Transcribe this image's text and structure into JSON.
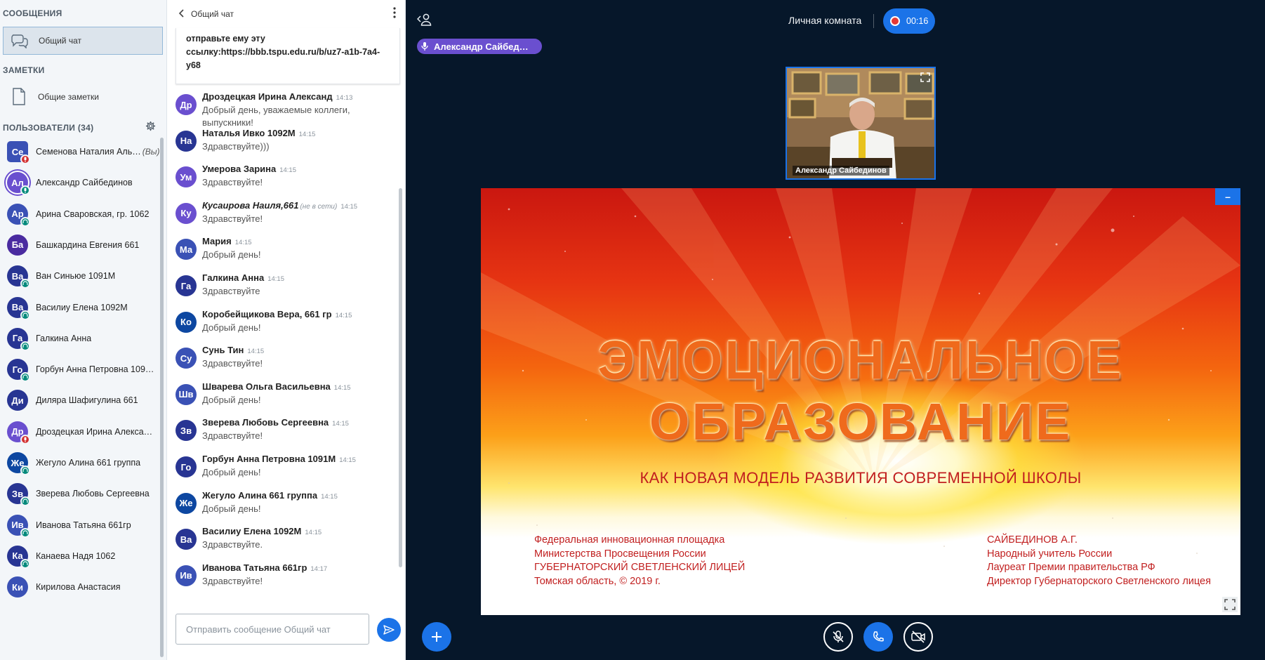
{
  "sidebar": {
    "messages_title": "СООБЩЕНИЯ",
    "public_chat": "Общий чат",
    "notes_title": "ЗАМЕТКИ",
    "shared_notes": "Общие заметки",
    "users_title": "ПОЛЬЗОВАТЕЛИ (34)",
    "you_label": "(Вы)",
    "users": [
      {
        "initials": "Се",
        "name": "Семенова Наталия Аль…",
        "color": "#3a51b5",
        "status": "muted",
        "me": true
      },
      {
        "initials": "Ал",
        "name": "Александр Сайбединов",
        "color": "#6a4fcf",
        "status": "talking",
        "me": false
      },
      {
        "initials": "Ар",
        "name": "Арина Сваровская, гр. 1062",
        "color": "#3a51b5",
        "status": "listen",
        "me": false
      },
      {
        "initials": "Ба",
        "name": "Башкардина Евгения 661",
        "color": "#4a2ba0",
        "status": "none",
        "me": false
      },
      {
        "initials": "Ва",
        "name": "Ван Синьюе 1091М",
        "color": "#283593",
        "status": "listen",
        "me": false
      },
      {
        "initials": "Ва",
        "name": "Василиу Елена 1092М",
        "color": "#283593",
        "status": "listen",
        "me": false
      },
      {
        "initials": "Га",
        "name": "Галкина Анна",
        "color": "#283593",
        "status": "listen",
        "me": false
      },
      {
        "initials": "Го",
        "name": "Горбун Анна Петровна 1091М",
        "color": "#283593",
        "status": "listen",
        "me": false
      },
      {
        "initials": "Ди",
        "name": "Диляра Шафигулина 661",
        "color": "#283593",
        "status": "none",
        "me": false
      },
      {
        "initials": "Др",
        "name": "Дроздецкая Ирина Алексан…",
        "color": "#6a4fcf",
        "status": "muted",
        "me": false
      },
      {
        "initials": "Же",
        "name": "Жегуло Алина 661 группа",
        "color": "#0d47a1",
        "status": "listen",
        "me": false
      },
      {
        "initials": "Зв",
        "name": "Зверева Любовь Сергеевна",
        "color": "#283593",
        "status": "listen",
        "me": false
      },
      {
        "initials": "Ив",
        "name": "Иванова Татьяна 661гр",
        "color": "#3a51b5",
        "status": "listen",
        "me": false
      },
      {
        "initials": "Ка",
        "name": "Канаева Надя 1062",
        "color": "#283593",
        "status": "listen",
        "me": false
      },
      {
        "initials": "Ки",
        "name": "Кирилова Анастасия",
        "color": "#3a51b5",
        "status": "none",
        "me": false
      }
    ]
  },
  "chat": {
    "title": "Общий чат",
    "link_text": "отправьте ему эту ссылку:https://bbb.tspu.edu.ru/b/uz7-a1b-7a4-y68",
    "offline_label": "(не в сети)",
    "input_placeholder": "Отправить сообщение Общий чат",
    "messages": [
      {
        "initials": "Др",
        "color": "#6a4fcf",
        "name": "Дроздецкая Ирина Александ",
        "time": "14:13",
        "text": "Добрый день, уважаемые коллеги, выпускники!",
        "offline": false
      },
      {
        "initials": "На",
        "color": "#283593",
        "name": "Наталья Ивко 1092М",
        "time": "14:15",
        "text": "Здравствуйте)))",
        "offline": false
      },
      {
        "initials": "Ум",
        "color": "#6a4fcf",
        "name": "Умерова Зарина",
        "time": "14:15",
        "text": "Здравствуйте!",
        "offline": false
      },
      {
        "initials": "Ку",
        "color": "#6a4fcf",
        "name": "Кусаирова Наиля,661",
        "time": "14:15",
        "text": "Здравствуйте!",
        "offline": true
      },
      {
        "initials": "Ма",
        "color": "#3a51b5",
        "name": "Мария",
        "time": "14:15",
        "text": "Добрый день!",
        "offline": false
      },
      {
        "initials": "Га",
        "color": "#283593",
        "name": "Галкина Анна",
        "time": "14:15",
        "text": "Здравствуйте",
        "offline": false
      },
      {
        "initials": "Ко",
        "color": "#0d47a1",
        "name": "Коробейщикова Вера, 661 гр",
        "time": "14:15",
        "text": "Добрый день!",
        "offline": false
      },
      {
        "initials": "Су",
        "color": "#3a51b5",
        "name": "Сунь Тин",
        "time": "14:15",
        "text": "Здравствуйте!",
        "offline": false
      },
      {
        "initials": "Шв",
        "color": "#3a51b5",
        "name": "Шварева Ольга Васильевна",
        "time": "14:15",
        "text": "Добрый день!",
        "offline": false
      },
      {
        "initials": "Зв",
        "color": "#283593",
        "name": "Зверева Любовь Сергеевна",
        "time": "14:15",
        "text": "Здравствуйте!",
        "offline": false
      },
      {
        "initials": "Го",
        "color": "#283593",
        "name": "Горбун Анна Петровна 1091М",
        "time": "14:15",
        "text": "Добрый день!",
        "offline": false
      },
      {
        "initials": "Же",
        "color": "#0d47a1",
        "name": "Жегуло Алина 661 группа",
        "time": "14:15",
        "text": "Добрый день!",
        "offline": false
      },
      {
        "initials": "Ва",
        "color": "#283593",
        "name": "Василиу Елена 1092М",
        "time": "14:15",
        "text": "Здравствуйте.",
        "offline": false
      },
      {
        "initials": "Ив",
        "color": "#3a51b5",
        "name": "Иванова Татьяна 661гр",
        "time": "14:17",
        "text": "Здравствуйте!",
        "offline": false
      }
    ]
  },
  "main": {
    "room_title": "Личная комната",
    "recording_time": "00:16",
    "talking_indicator": "Александр Сайбед…",
    "webcam_name": "Александр Сайбединов"
  },
  "slide": {
    "title_line1": "ЭМОЦИОНАЛЬНОЕ",
    "title_line2": "ОБРАЗОВАНИЕ",
    "subtitle": "КАК НОВАЯ МОДЕЛЬ РАЗВИТИЯ СОВРЕМЕННОЙ ШКОЛЫ",
    "left_lines": [
      "Федеральная инновационная площадка",
      "Министерства Просвещения России",
      "ГУБЕРНАТОРСКИЙ СВЕТЛЕНСКИЙ ЛИЦЕЙ",
      "Томская область,  © 2019 г."
    ],
    "right_lines": [
      "САЙБЕДИНОВ А.Г.",
      "Народный учитель России",
      "Лауреат Премии правительства РФ",
      "Директор Губернаторского Светленского лицея"
    ]
  },
  "colors": {
    "accent": "#1b73e8",
    "talking": "#6a4fcf",
    "status_listen": "#00897b",
    "status_muted": "#d32f2f",
    "main_bg": "#06172a"
  },
  "icons": {
    "public_chat": "chat-bubbles-icon",
    "notes": "document-icon",
    "settings": "gear-icon",
    "back": "chevron-left-icon",
    "menu": "vertical-dots-icon",
    "send": "send-icon",
    "presenter": "user-icon",
    "mic": "microphone-icon",
    "plus": "plus-icon",
    "mic_off": "microphone-off-icon",
    "phone": "phone-icon",
    "camera_off": "camera-off-icon",
    "fullscreen": "fullscreen-icon",
    "minimize": "minimize-icon"
  }
}
